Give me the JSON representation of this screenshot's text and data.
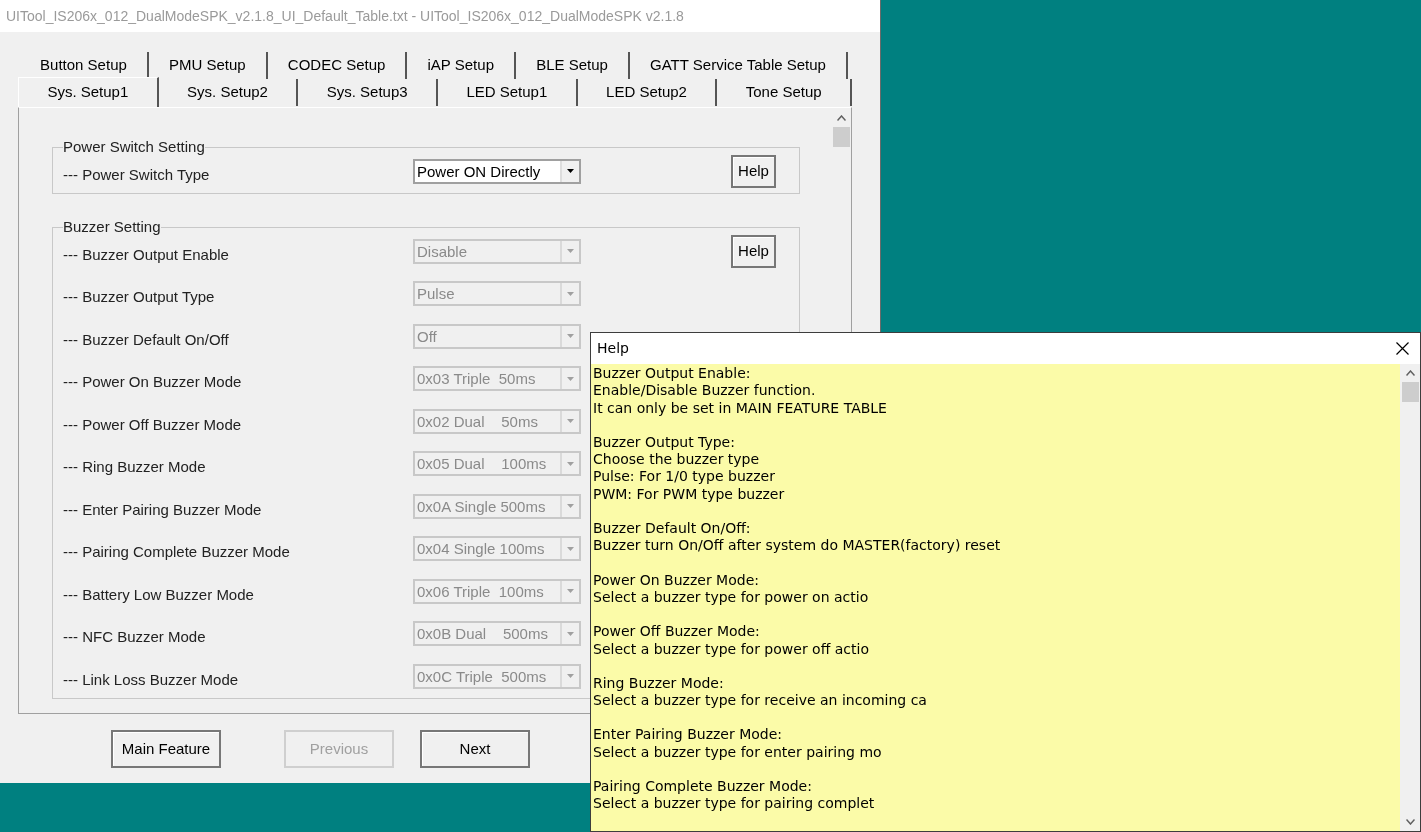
{
  "window": {
    "title": "UITool_IS206x_012_DualModeSPK_v2.1.8_UI_Default_Table.txt - UITool_IS206x_012_DualModeSPK v2.1.8"
  },
  "tab_rows": [
    {
      "tabs": [
        {
          "label": "Button Setup",
          "selected": false
        },
        {
          "label": "PMU Setup",
          "selected": false
        },
        {
          "label": "CODEC Setup",
          "selected": false
        },
        {
          "label": "iAP Setup",
          "selected": false
        },
        {
          "label": "BLE Setup",
          "selected": false
        },
        {
          "label": "GATT Service Table Setup",
          "selected": false
        }
      ]
    },
    {
      "tabs": [
        {
          "label": "Sys. Setup1",
          "selected": true
        },
        {
          "label": "Sys. Setup2",
          "selected": false
        },
        {
          "label": "Sys. Setup3",
          "selected": false
        },
        {
          "label": "LED Setup1",
          "selected": false
        },
        {
          "label": "LED Setup2",
          "selected": false
        },
        {
          "label": "Tone Setup",
          "selected": false
        }
      ]
    }
  ],
  "groups": [
    {
      "title": "Power Switch Setting",
      "help_button": "Help",
      "settings": [
        {
          "label": "--- Power Switch Type",
          "value": "Power ON Directly",
          "disabled": false
        }
      ]
    },
    {
      "title": "Buzzer Setting",
      "help_button": "Help",
      "settings": [
        {
          "label": "--- Buzzer Output Enable",
          "value": "Disable",
          "disabled": true
        },
        {
          "label": "--- Buzzer Output Type",
          "value": "Pulse",
          "disabled": true
        },
        {
          "label": "--- Buzzer Default On/Off",
          "value": "Off",
          "disabled": true
        },
        {
          "label": "--- Power On Buzzer Mode",
          "value": "0x03 Triple  50ms",
          "disabled": true
        },
        {
          "label": "--- Power Off Buzzer Mode",
          "value": "0x02 Dual    50ms",
          "disabled": true
        },
        {
          "label": "--- Ring Buzzer Mode",
          "value": "0x05 Dual    100ms",
          "disabled": true
        },
        {
          "label": "--- Enter Pairing Buzzer Mode",
          "value": "0x0A Single 500ms",
          "disabled": true
        },
        {
          "label": "--- Pairing Complete Buzzer Mode",
          "value": "0x04 Single 100ms",
          "disabled": true
        },
        {
          "label": "--- Battery Low Buzzer Mode",
          "value": "0x06 Triple  100ms",
          "disabled": true
        },
        {
          "label": "--- NFC Buzzer Mode",
          "value": "0x0B Dual    500ms",
          "disabled": true
        },
        {
          "label": "--- Link Loss Buzzer Mode",
          "value": "0x0C Triple  500ms",
          "disabled": true
        }
      ]
    }
  ],
  "buttons": [
    {
      "label": "Main Feature",
      "disabled": false
    },
    {
      "label": "Previous",
      "disabled": true
    },
    {
      "label": "Next",
      "disabled": false
    }
  ],
  "help_window": {
    "title": "Help",
    "paragraphs": [
      {
        "lines": [
          "Buzzer Output Enable:",
          "Enable/Disable Buzzer function.",
          "It can only be set in MAIN FEATURE TABLE"
        ]
      },
      {
        "lines": [
          "Buzzer Output Type:",
          "Choose the buzzer type",
          "Pulse: For 1/0 type buzzer",
          "PWM: For PWM type buzzer"
        ]
      },
      {
        "lines": [
          "Buzzer Default On/Off:",
          "Buzzer turn On/Off after system do MASTER(factory) reset"
        ]
      },
      {
        "lines": [
          "Power On Buzzer Mode:",
          "Select a buzzer type for power on actio"
        ]
      },
      {
        "lines": [
          "Power Off Buzzer Mode:",
          "Select a buzzer type for power off actio"
        ]
      },
      {
        "lines": [
          "Ring Buzzer Mode:",
          "Select a buzzer type for receive an incoming ca"
        ]
      },
      {
        "lines": [
          "Enter Pairing Buzzer Mode:",
          "Select a buzzer type for enter pairing mo"
        ]
      },
      {
        "lines": [
          "Pairing Complete Buzzer Mode:",
          "Select a buzzer type for pairing complet"
        ]
      }
    ]
  }
}
